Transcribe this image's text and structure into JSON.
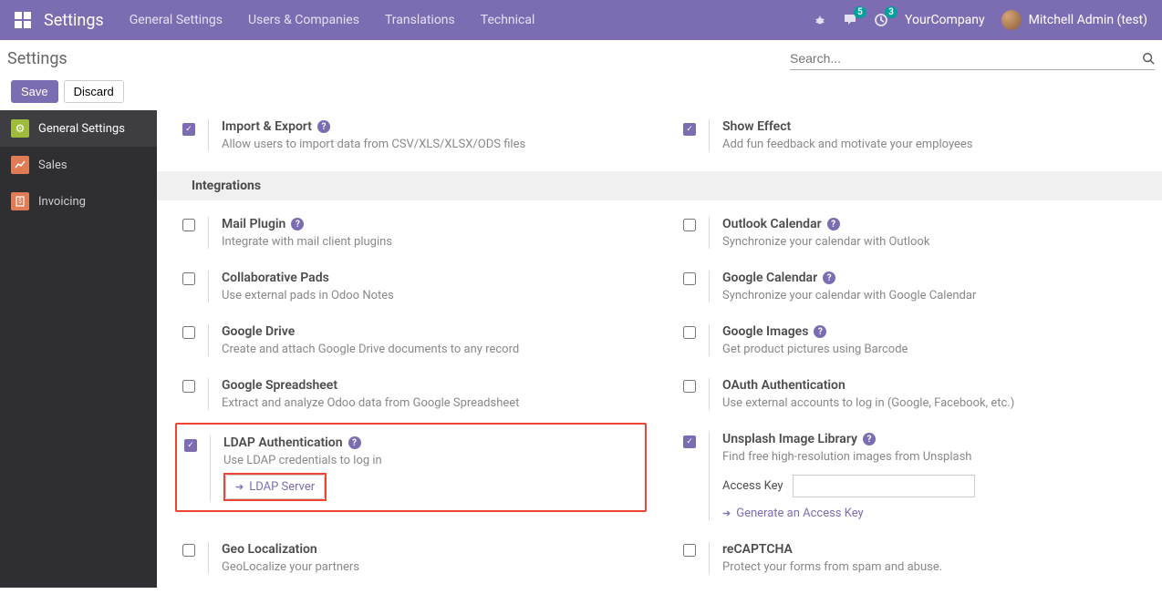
{
  "topnav": {
    "brand": "Settings",
    "menu": [
      "General Settings",
      "Users & Companies",
      "Translations",
      "Technical"
    ],
    "messages_count": "5",
    "activities_count": "3",
    "company": "YourCompany",
    "user": "Mitchell Admin (test)"
  },
  "page": {
    "title": "Settings",
    "search_placeholder": "Search..."
  },
  "actions": {
    "save": "Save",
    "discard": "Discard"
  },
  "sidebar": {
    "items": [
      {
        "label": "General Settings"
      },
      {
        "label": "Sales"
      },
      {
        "label": "Invoicing"
      }
    ]
  },
  "sections": {
    "integrations_header": "Integrations"
  },
  "settings": {
    "import_export": {
      "title": "Import & Export",
      "desc": "Allow users to import data from CSV/XLS/XLSX/ODS files"
    },
    "show_effect": {
      "title": "Show Effect",
      "desc": "Add fun feedback and motivate your employees"
    },
    "mail_plugin": {
      "title": "Mail Plugin",
      "desc": "Integrate with mail client plugins"
    },
    "outlook_calendar": {
      "title": "Outlook Calendar",
      "desc": "Synchronize your calendar with Outlook"
    },
    "collab_pads": {
      "title": "Collaborative Pads",
      "desc": "Use external pads in Odoo Notes"
    },
    "google_calendar": {
      "title": "Google Calendar",
      "desc": "Synchronize your calendar with Google Calendar"
    },
    "google_drive": {
      "title": "Google Drive",
      "desc": "Create and attach Google Drive documents to any record"
    },
    "google_images": {
      "title": "Google Images",
      "desc": "Get product pictures using Barcode"
    },
    "google_spreadsheet": {
      "title": "Google Spreadsheet",
      "desc": "Extract and analyze Odoo data from Google Spreadsheet"
    },
    "oauth": {
      "title": "OAuth Authentication",
      "desc": "Use external accounts to log in (Google, Facebook, etc.)"
    },
    "ldap": {
      "title": "LDAP Authentication",
      "desc": "Use LDAP credentials to log in",
      "button": "LDAP Server"
    },
    "unsplash": {
      "title": "Unsplash Image Library",
      "desc": "Find free high-resolution images from Unsplash",
      "access_key_label": "Access Key",
      "generate_link": "Generate an Access Key"
    },
    "geo": {
      "title": "Geo Localization",
      "desc": "GeoLocalize your partners"
    },
    "recaptcha": {
      "title": "reCAPTCHA",
      "desc": "Protect your forms from spam and abuse."
    }
  }
}
